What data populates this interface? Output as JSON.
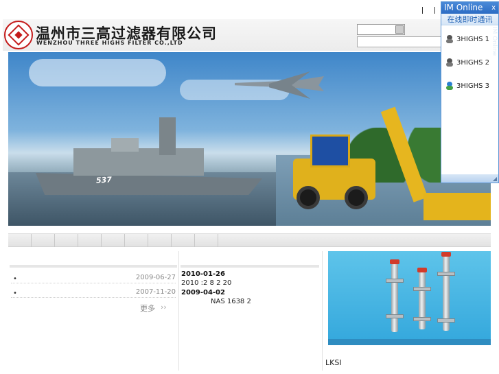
{
  "header": {
    "company_cn": "温州市三高过滤器有限公司",
    "company_en": "WENZHOU THREE HIGHS FILTER CO.,LTD"
  },
  "banner": {
    "ship_number": "537"
  },
  "news": {
    "items": [
      {
        "bullet": "•",
        "date": "2009-06-27"
      },
      {
        "bullet": "•",
        "date": "2007-11-20"
      }
    ],
    "more_label": "更多",
    "more_arrow": "››"
  },
  "updates": {
    "entries": [
      {
        "date": "2010-01-26",
        "text": "2010    :2 8  2 20"
      },
      {
        "date": "2009-04-02",
        "text": "NAS 1638 2"
      }
    ]
  },
  "product": {
    "caption": "LKSI"
  },
  "im": {
    "title": "IM Online",
    "close": "x",
    "subtitle": "在线即时通讯",
    "contacts": [
      {
        "label": "3HIGHS 1",
        "icon": "qq-offline-icon"
      },
      {
        "label": "3HIGHS 2",
        "icon": "qq-offline-icon"
      },
      {
        "label": "3HIGHS 3",
        "icon": "qq-online-icon"
      }
    ],
    "watermark": "IM Online",
    "resize_glyph": "◢"
  },
  "topbar": {
    "separators": [
      "|",
      "|"
    ]
  },
  "colors": {
    "brand_red": "#c41a1a",
    "im_blue": "#2b6cc4",
    "product_blue": "#33a7dc"
  }
}
